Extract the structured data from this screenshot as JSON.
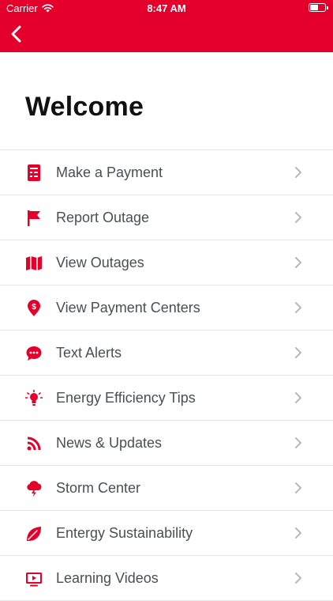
{
  "status_bar": {
    "carrier": "Carrier",
    "time": "8:47 AM",
    "battery_level": 0.6
  },
  "colors": {
    "brand": "#e4002b",
    "text": "#4a4f55",
    "chevron": "#b8b8b8",
    "divider": "#e5e5e5"
  },
  "page": {
    "title": "Welcome"
  },
  "menu": {
    "items": [
      {
        "label": "Make a Payment",
        "icon": "payment-icon"
      },
      {
        "label": "Report Outage",
        "icon": "flag-icon"
      },
      {
        "label": "View Outages",
        "icon": "map-icon"
      },
      {
        "label": "View Payment Centers",
        "icon": "dollar-pin-icon"
      },
      {
        "label": "Text Alerts",
        "icon": "chat-bubble-icon"
      },
      {
        "label": "Energy Efficiency Tips",
        "icon": "lightbulb-icon"
      },
      {
        "label": "News & Updates",
        "icon": "rss-icon"
      },
      {
        "label": "Storm Center",
        "icon": "storm-cloud-icon"
      },
      {
        "label": "Entergy Sustainability",
        "icon": "leaf-icon"
      },
      {
        "label": "Learning Videos",
        "icon": "video-icon"
      }
    ]
  }
}
